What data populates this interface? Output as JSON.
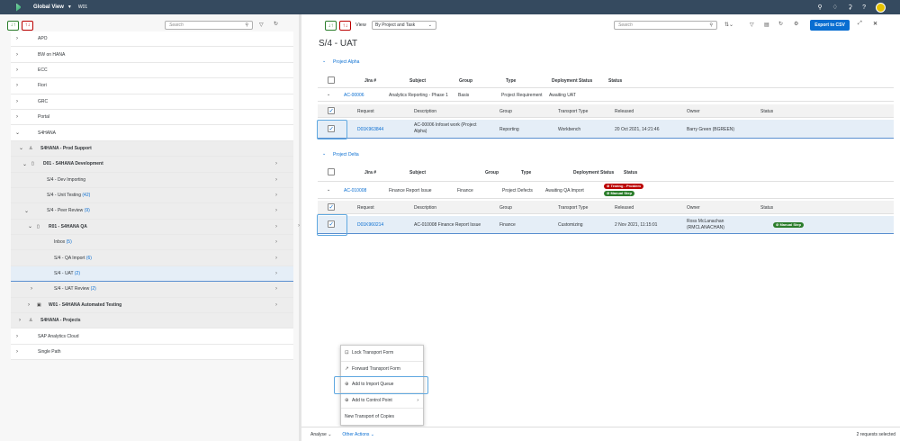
{
  "topbar": {
    "app_title": "Global View",
    "context": "W01"
  },
  "left": {
    "search_placeholder": "Search",
    "tree": [
      {
        "label": "APO"
      },
      {
        "label": "BW on HANA"
      },
      {
        "label": "ECC"
      },
      {
        "label": "Fiori"
      },
      {
        "label": "GRC"
      },
      {
        "label": "Portal"
      },
      {
        "label": "S4HANA"
      },
      {
        "label": "S4HANA - Prod Support"
      },
      {
        "label": "D01 - S4HANA Development"
      },
      {
        "label": "S/4 - Dev Importing"
      },
      {
        "label": "S/4 - Unit Testing",
        "count": "(42)"
      },
      {
        "label": "S/4 - Peer Review",
        "count": "(9)"
      },
      {
        "label": "R01 - S4HANA QA"
      },
      {
        "label": "Inbox",
        "count": "(5)"
      },
      {
        "label": "S/4 - QA Import",
        "count": "(6)"
      },
      {
        "label": "S/4 - UAT",
        "count": "(2)"
      },
      {
        "label": "S/4 - UAT Review",
        "count": "(2)"
      },
      {
        "label": "W01 - S4HANA Automated Testing"
      },
      {
        "label": "S4HANA - Projects"
      },
      {
        "label": "SAP Analytics Cloud"
      },
      {
        "label": "Single Path"
      }
    ]
  },
  "right": {
    "view_label": "View",
    "view_value": "By Project and Task",
    "search_placeholder": "Search",
    "export_label": "Export to CSV",
    "page_title": "S/4 - UAT",
    "header_cols": [
      "Jira #",
      "Subject",
      "Group",
      "Type",
      "Deployment Status",
      "Status"
    ],
    "sub_cols": [
      "Request",
      "Description",
      "Group",
      "Transport Type",
      "Released",
      "Owner",
      "Status"
    ],
    "projects": [
      {
        "name": "Project Alpha",
        "jira": "AC-00006",
        "subject": "Analytics Reporting - Phase 1",
        "group": "Basis",
        "type": "Project Requirement",
        "deployment_status": "Awaiting UAT",
        "request": {
          "id": "D01K963844",
          "description": "AC-00006 Infoset work (Project Alpha)",
          "group": "Reporting",
          "transport_type": "Workbench",
          "released": "20 Oct 2021, 14:21:46",
          "owner": "Barry Green (BGREEN)",
          "status": ""
        }
      },
      {
        "name": "Project Delta",
        "jira": "AC-010008",
        "subject": "Finance Report Issue",
        "group": "Finance",
        "type": "Project Defects",
        "deployment_status": "Awaiting QA Import",
        "status_badges": [
          "Testing - Problem",
          "Manual Step"
        ],
        "request": {
          "id": "D01K960214",
          "description": "AC-010008 Finance Report Issue",
          "group": "Finance",
          "transport_type": "Customizing",
          "released": "2 Nov 2021, 11:15:01",
          "owner": "Ross McLanachan (RMCLANACHAN)",
          "status": "Manual Step"
        }
      }
    ],
    "context_menu": [
      {
        "label": "Lock Transport Form",
        "icon": "lock-icon"
      },
      {
        "label": "Forward Transport Form",
        "icon": "forward-icon"
      },
      {
        "label": "Add to Import Queue",
        "icon": "add-icon"
      },
      {
        "label": "Add to Control Point",
        "icon": "add-icon"
      },
      {
        "label": "New Transport of Copies",
        "icon": ""
      }
    ],
    "footer": {
      "analyse": "Analyse",
      "other_actions": "Other Actions",
      "selected": "2 requests selected"
    }
  }
}
